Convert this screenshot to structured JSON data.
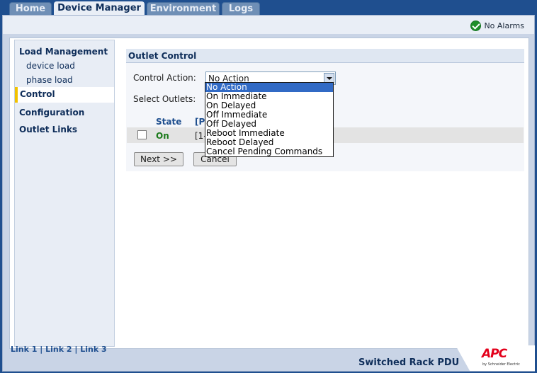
{
  "tabs": [
    {
      "label": "Home"
    },
    {
      "label": "Device Manager"
    },
    {
      "label": "Environment"
    },
    {
      "label": "Logs"
    }
  ],
  "status": {
    "alarm_text": "No Alarms",
    "alarm_icon": "check-circle-icon"
  },
  "sidebar": {
    "load_management": "Load Management",
    "device_load": "device load",
    "phase_load": "phase load",
    "control": "Control",
    "configuration": "Configuration",
    "outlet_links": "Outlet Links"
  },
  "panel": {
    "title": "Outlet Control",
    "control_action_label": "Control Action:",
    "select_outlets_label": "Select Outlets:",
    "control_action_value": "No Action",
    "col_state": "State",
    "col_second": "[P",
    "row_state": "On",
    "row_second": "[1-",
    "next_button": "Next >>",
    "cancel_button": "Cancel"
  },
  "dropdown_options": [
    "No Action",
    "On Immediate",
    "On Delayed",
    "Off Immediate",
    "Off Delayed",
    "Reboot Immediate",
    "Reboot Delayed",
    "Cancel Pending Commands"
  ],
  "footer": {
    "link1": "Link 1",
    "link2": "Link 2",
    "link3": "Link 3",
    "sep": "|",
    "product": "Switched Rack PDU",
    "logo": "APC",
    "logo_sub": "by Schneider Electric"
  },
  "colors": {
    "accent": "#f2c200",
    "brand": "#e3001b",
    "selected": "#316ac5"
  }
}
